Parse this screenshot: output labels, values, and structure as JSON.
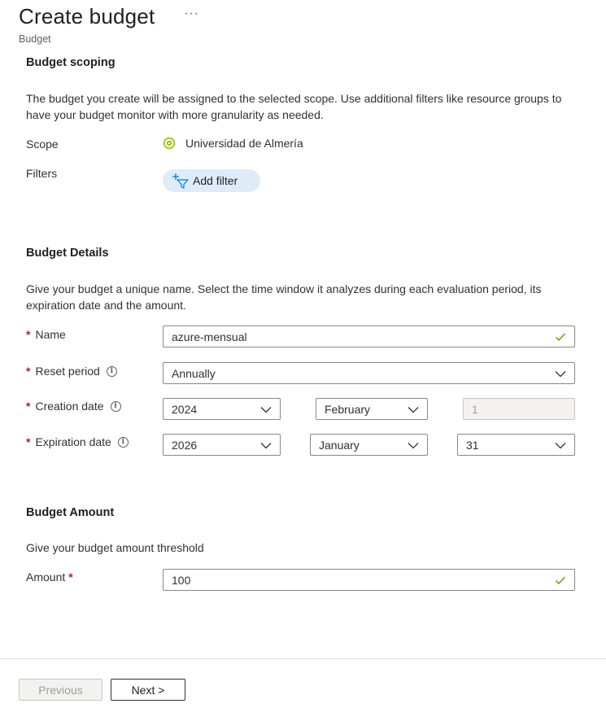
{
  "header": {
    "title": "Create budget",
    "more_label": "···",
    "subtitle": "Budget"
  },
  "scoping": {
    "title": "Budget scoping",
    "description": "The budget you create will be assigned to the selected scope. Use additional filters like resource groups to have your budget monitor with more granularity as needed.",
    "scope_label": "Scope",
    "scope_value": "Universidad de Almería",
    "filters_label": "Filters",
    "add_filter_label": "Add filter"
  },
  "details": {
    "title": "Budget Details",
    "description": "Give your budget a unique name. Select the time window it analyzes during each evaluation period, its expiration date and the amount.",
    "name_label": "Name",
    "name_value": "azure-mensual",
    "reset_label": "Reset period",
    "reset_value": "Annually",
    "creation_label": "Creation date",
    "creation_year": "2024",
    "creation_month": "February",
    "creation_day": "1",
    "expiration_label": "Expiration date",
    "expiration_year": "2026",
    "expiration_month": "January",
    "expiration_day": "31",
    "required_mark": "*",
    "info_glyph": "i"
  },
  "amount": {
    "title": "Budget Amount",
    "description": "Give your budget amount threshold",
    "amount_label": "Amount",
    "amount_value": "100"
  },
  "footer": {
    "previous_label": "Previous",
    "next_label": "Next >"
  },
  "colors": {
    "accent_blue": "#0078d4",
    "valid_green": "#57a300",
    "required_red": "#a4262c",
    "filter_pill_bg": "#deecf9"
  }
}
